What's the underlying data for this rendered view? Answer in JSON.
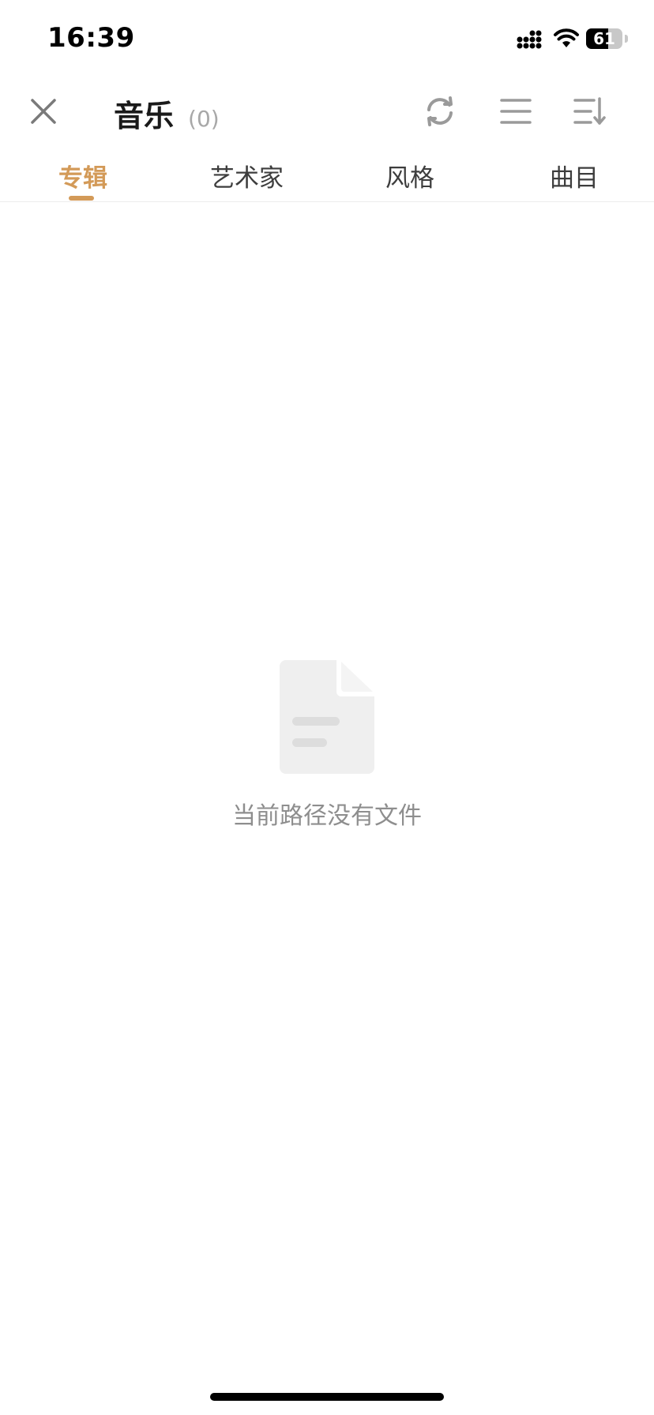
{
  "status_bar": {
    "time": "16:39",
    "battery_level": "61",
    "battery_fraction": 0.61
  },
  "header": {
    "title": "音乐",
    "count": "(0)",
    "icons": {
      "close": "close-icon",
      "refresh": "refresh-icon",
      "list": "list-view-icon",
      "sort": "sort-icon"
    }
  },
  "tabs": [
    {
      "label": "专辑",
      "active": true
    },
    {
      "label": "艺术家",
      "active": false
    },
    {
      "label": "风格",
      "active": false
    },
    {
      "label": "曲目",
      "active": false
    }
  ],
  "empty_state": {
    "icon": "empty-file-icon",
    "message": "当前路径没有文件"
  },
  "colors": {
    "accent": "#d39a58",
    "icon_gray": "#9a9a9a",
    "empty_icon": "#efefef",
    "message_gray": "#8e8e8e"
  }
}
